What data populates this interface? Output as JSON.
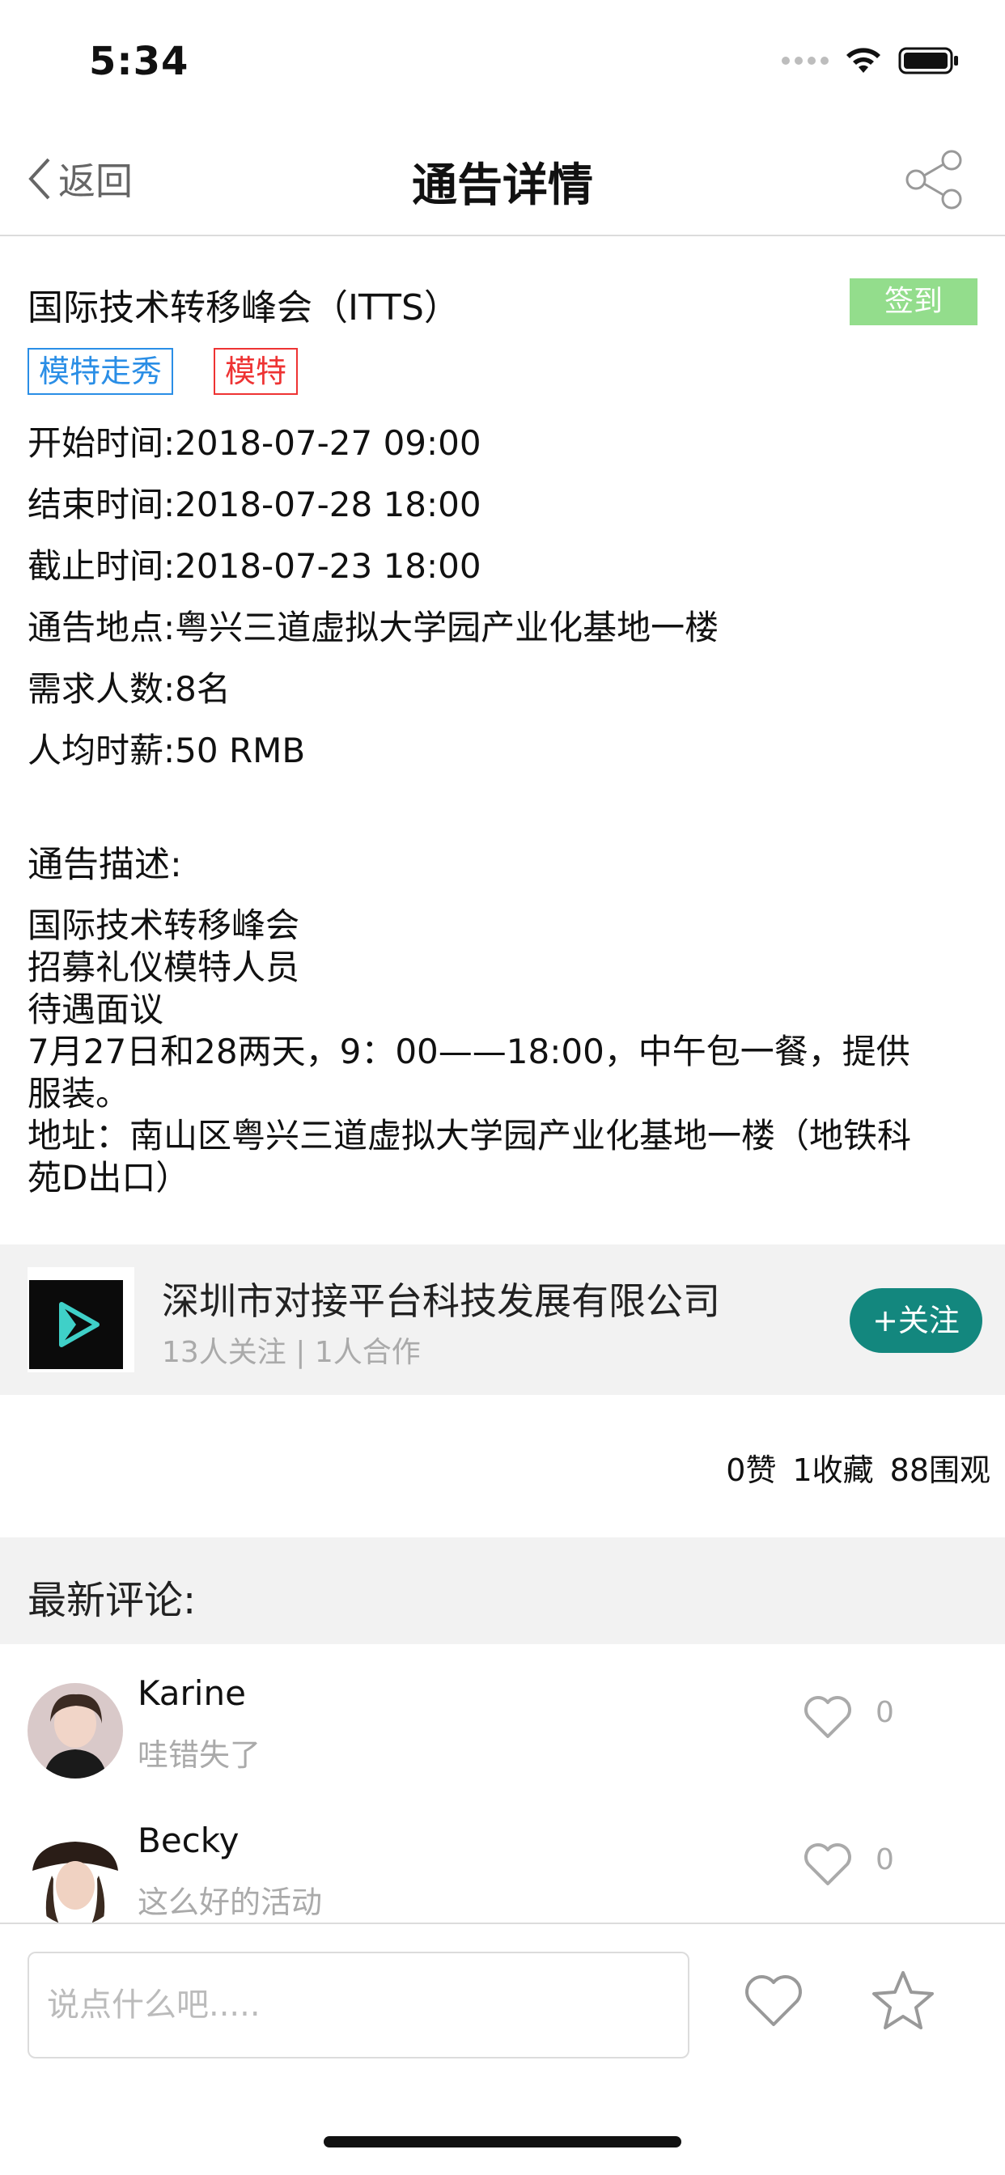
{
  "status_bar": {
    "time": "5:34"
  },
  "nav": {
    "back_label": "返回",
    "title": "通告详情"
  },
  "event": {
    "title": "国际技术转移峰会（ITTS）",
    "checkin_label": "签到",
    "tags": [
      "模特走秀",
      "模特"
    ],
    "start": "开始时间:2018-07-27 09:00",
    "end": "结束时间:2018-07-28 18:00",
    "deadline": "截止时间:2018-07-23 18:00",
    "location": "通告地点:粤兴三道虚拟大学园产业化基地一楼",
    "headcount": "需求人数:8名",
    "pay": "人均时薪:50 RMB"
  },
  "description": {
    "title": "通告描述:",
    "lines": [
      "国际技术转移峰会",
      "招募礼仪模特人员",
      "待遇面议",
      "7月27日和28两天，9：00——18:00，中午包一餐，提供",
      "服装。",
      "地址：南山区粤兴三道虚拟大学园产业化基地一楼（地铁科",
      "苑D出口）"
    ]
  },
  "company": {
    "name": "深圳市对接平台科技发展有限公司",
    "stats": "13人关注 | 1人合作",
    "follow_label": "+关注"
  },
  "stats": {
    "likes": "0赞",
    "favorites": "1收藏",
    "views": "88围观"
  },
  "comments_section": {
    "title": "最新评论:",
    "items": [
      {
        "name": "Karine",
        "text": "哇错失了",
        "likes": "0"
      },
      {
        "name": "Becky",
        "text": "这么好的活动",
        "likes": "0"
      }
    ]
  },
  "bottom_bar": {
    "input_placeholder": "说点什么吧....."
  },
  "colors": {
    "checkin": "#93dd8c",
    "tag_blue": "#2a8ee6",
    "tag_red": "#ee3333",
    "follow": "#13877e"
  },
  "icons": [
    "back-chevron-icon",
    "share-icon",
    "heart-icon",
    "star-icon",
    "wifi-icon",
    "battery-icon"
  ]
}
